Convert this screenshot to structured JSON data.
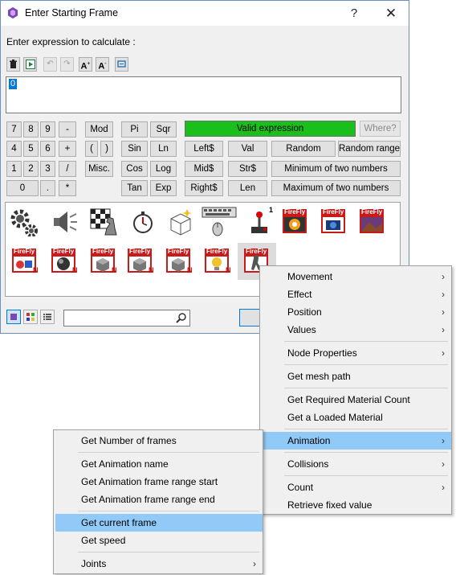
{
  "window": {
    "title": "Enter Starting Frame",
    "help_glyph": "?",
    "close_glyph": "✕"
  },
  "expression_label": "Enter expression to calculate :",
  "toolbar": {
    "delete_icon": "trash-icon",
    "insert_icon": "insert-icon",
    "undo_icon": "undo-icon",
    "redo_icon": "redo-icon",
    "font_up_label": "A",
    "font_down_label": "A",
    "fit_icon": "fit-icon"
  },
  "expression_value": "0",
  "status": {
    "text": "Valid expression",
    "color": "#1bbf1b"
  },
  "where_label": "Where?",
  "keypad": {
    "row1": [
      "7",
      "8",
      "9",
      "-"
    ],
    "row2": [
      "4",
      "5",
      "6",
      "+"
    ],
    "row3": [
      "1",
      "2",
      "3",
      "/"
    ],
    "row4": [
      "0",
      ".",
      "*"
    ]
  },
  "functions": {
    "mod": "Mod",
    "lparen": "(",
    "rparen": ")",
    "misc": "Misc.",
    "pi": "Pi",
    "sqr": "Sqr",
    "sin": "Sin",
    "ln": "Ln",
    "cos": "Cos",
    "log": "Log",
    "tan": "Tan",
    "exp": "Exp",
    "left": "Left$",
    "val": "Val",
    "random": "Random",
    "random_range": "Random range",
    "mid": "Mid$",
    "str": "Str$",
    "min": "Minimum of two numbers",
    "right": "Right$",
    "len": "Len",
    "max": "Maximum of two numbers"
  },
  "object_icons": [
    "gears-icon",
    "speaker-icon",
    "chess-icon",
    "stopwatch-icon",
    "box-icon",
    "keyboard-mouse-icon",
    "joystick-icon",
    "firefly-icon",
    "firefly-camera-icon",
    "firefly-landscape-icon",
    "firefly-object-icon",
    "firefly-sphere-icon",
    "firefly-cube-icon",
    "firefly-cube-icon",
    "firefly-cube-icon",
    "firefly-light-icon",
    "firefly-animation-icon"
  ],
  "joystick_badge": "1",
  "firefly_label": "FireFly",
  "new_badge": "N",
  "submenu_main": {
    "items": [
      {
        "label": "Movement",
        "arrow": "›"
      },
      {
        "label": "Effect",
        "arrow": "›"
      },
      {
        "label": "Position",
        "arrow": "›"
      },
      {
        "label": "Values",
        "arrow": "›"
      },
      {
        "label": "Node Properties",
        "arrow": "›"
      },
      {
        "label": "Get mesh path",
        "arrow": ""
      },
      {
        "label": "Get Required Material Count",
        "arrow": ""
      },
      {
        "label": "Get a Loaded Material",
        "arrow": ""
      },
      {
        "label": "Animation",
        "arrow": "›"
      },
      {
        "label": "Collisions",
        "arrow": "›"
      },
      {
        "label": "Count",
        "arrow": "›"
      },
      {
        "label": "Retrieve fixed value",
        "arrow": ""
      }
    ]
  },
  "submenu_animation": {
    "items": [
      {
        "label": "Get Number of frames",
        "arrow": ""
      },
      {
        "label": "Get Animation name",
        "arrow": ""
      },
      {
        "label": "Get Animation frame range start",
        "arrow": ""
      },
      {
        "label": "Get Animation frame range end",
        "arrow": ""
      },
      {
        "label": "Get current frame",
        "arrow": ""
      },
      {
        "label": "Get speed",
        "arrow": ""
      },
      {
        "label": "Joints",
        "arrow": "›"
      }
    ]
  },
  "highlight_color": "#91c9f7"
}
